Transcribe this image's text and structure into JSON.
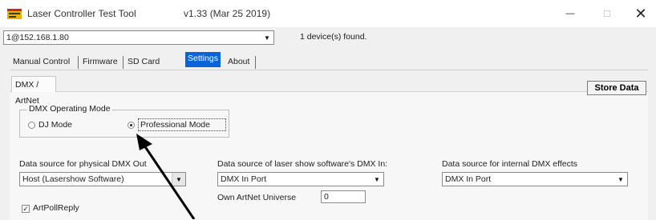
{
  "window": {
    "title": "Laser Controller Test Tool",
    "version": "v1.33     (Mar 25 2019)",
    "controls": {
      "minimize": "—",
      "maximize": "☐",
      "close": "✕"
    }
  },
  "device": {
    "selected": "1@152.168.1.80",
    "status": "1 device(s) found."
  },
  "tabs": [
    {
      "label": "Manual Control"
    },
    {
      "label": "Firmware"
    },
    {
      "label": "SD Card"
    },
    {
      "label": "Settings",
      "active": true
    },
    {
      "label": "About"
    }
  ],
  "subtab": {
    "label": "DMX / ArtNet"
  },
  "store_button": "Store Data",
  "dmx_mode": {
    "legend": "DMX Operating Mode",
    "options": [
      {
        "label": "DJ Mode",
        "checked": false
      },
      {
        "label": "Professional Mode",
        "checked": true
      }
    ]
  },
  "physical_dmx": {
    "label": "Data source for physical DMX Out",
    "value": "Host (Lasershow Software)"
  },
  "laser_show_dmx": {
    "label": "Data source of laser show software's DMX In:",
    "value": "DMX In Port"
  },
  "internal_dmx": {
    "label": "Data source for internal DMX effects",
    "value": "DMX In Port"
  },
  "artnet_universe": {
    "label": "Own ArtNet Universe",
    "value": "0"
  },
  "artpollreply": {
    "label": "ArtPollReply",
    "checked": true,
    "check_glyph": "✓"
  },
  "dropdown_glyph": "▼",
  "colors": {
    "active_tab": "#0a63d8",
    "app_icon": "#e8b400"
  }
}
